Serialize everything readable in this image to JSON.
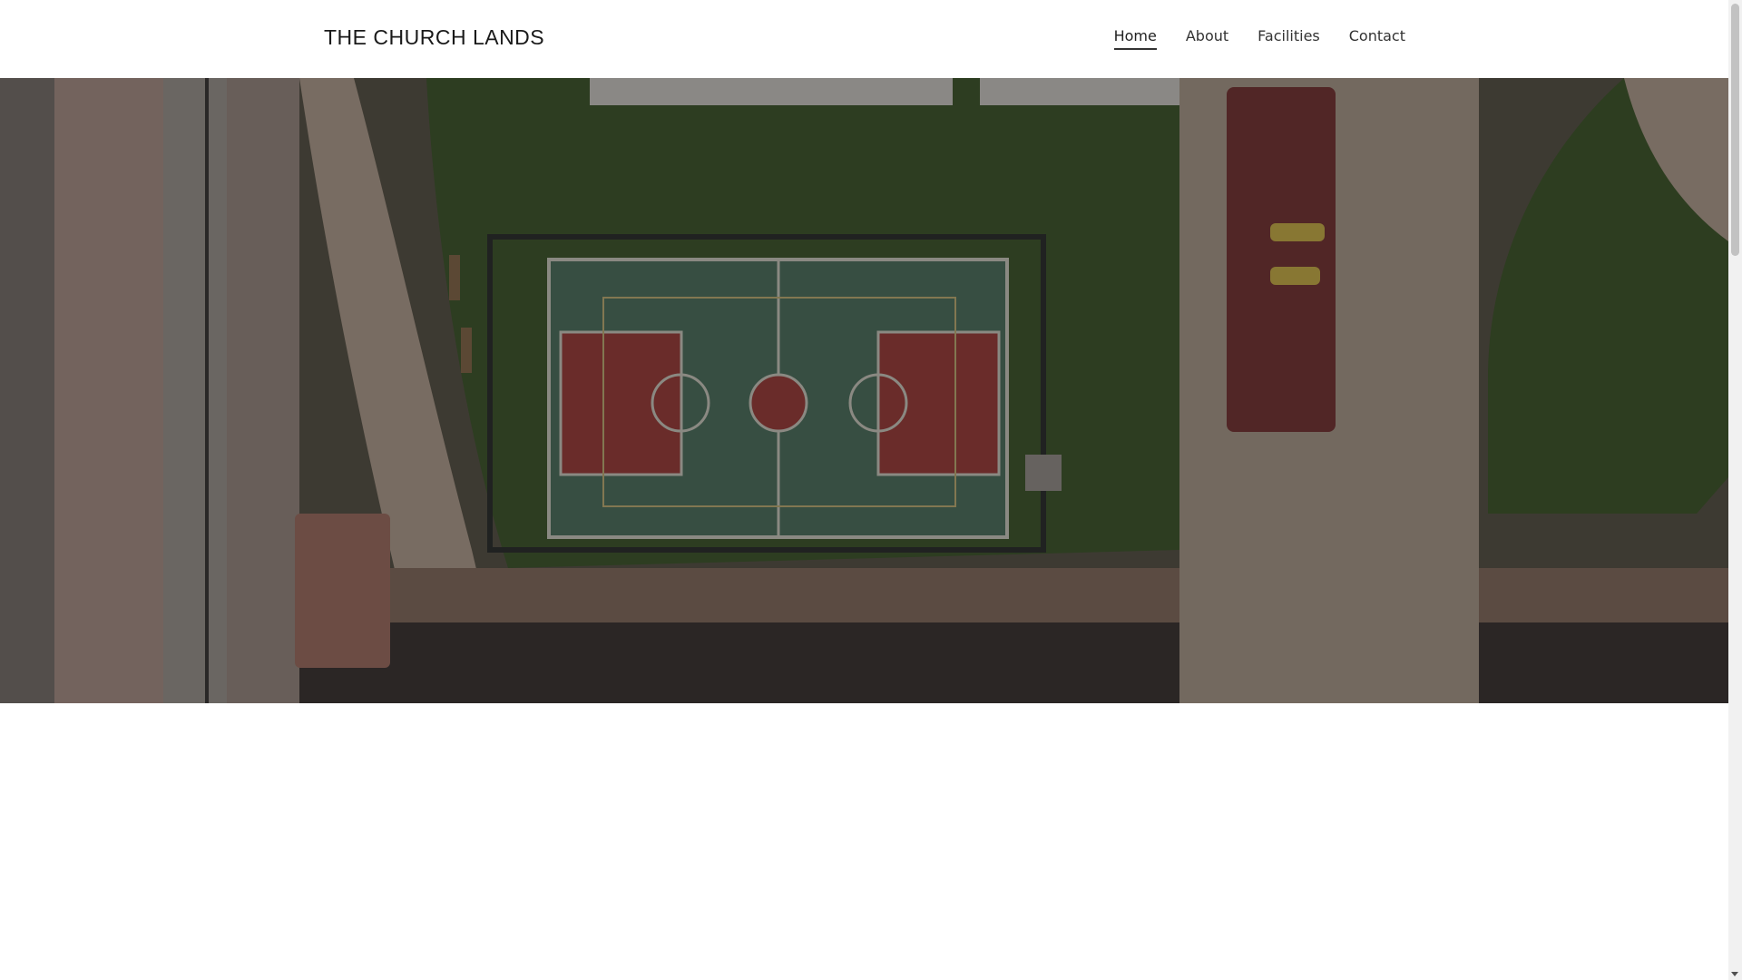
{
  "header": {
    "site_title": "THE CHURCH LANDS",
    "nav": [
      {
        "label": "Home",
        "active": true
      },
      {
        "label": "About",
        "active": false
      },
      {
        "label": "Facilities",
        "active": false
      },
      {
        "label": "Contact",
        "active": false
      }
    ]
  },
  "hero": {
    "image": "aerial-view-basketball-court-icon"
  },
  "colors": {
    "grass": "#3f5a2c",
    "court_green": "#4f7562",
    "court_red": "#a23e3b",
    "path": "#b8a592",
    "overlay": "rgba(15,15,15,0.38)"
  }
}
